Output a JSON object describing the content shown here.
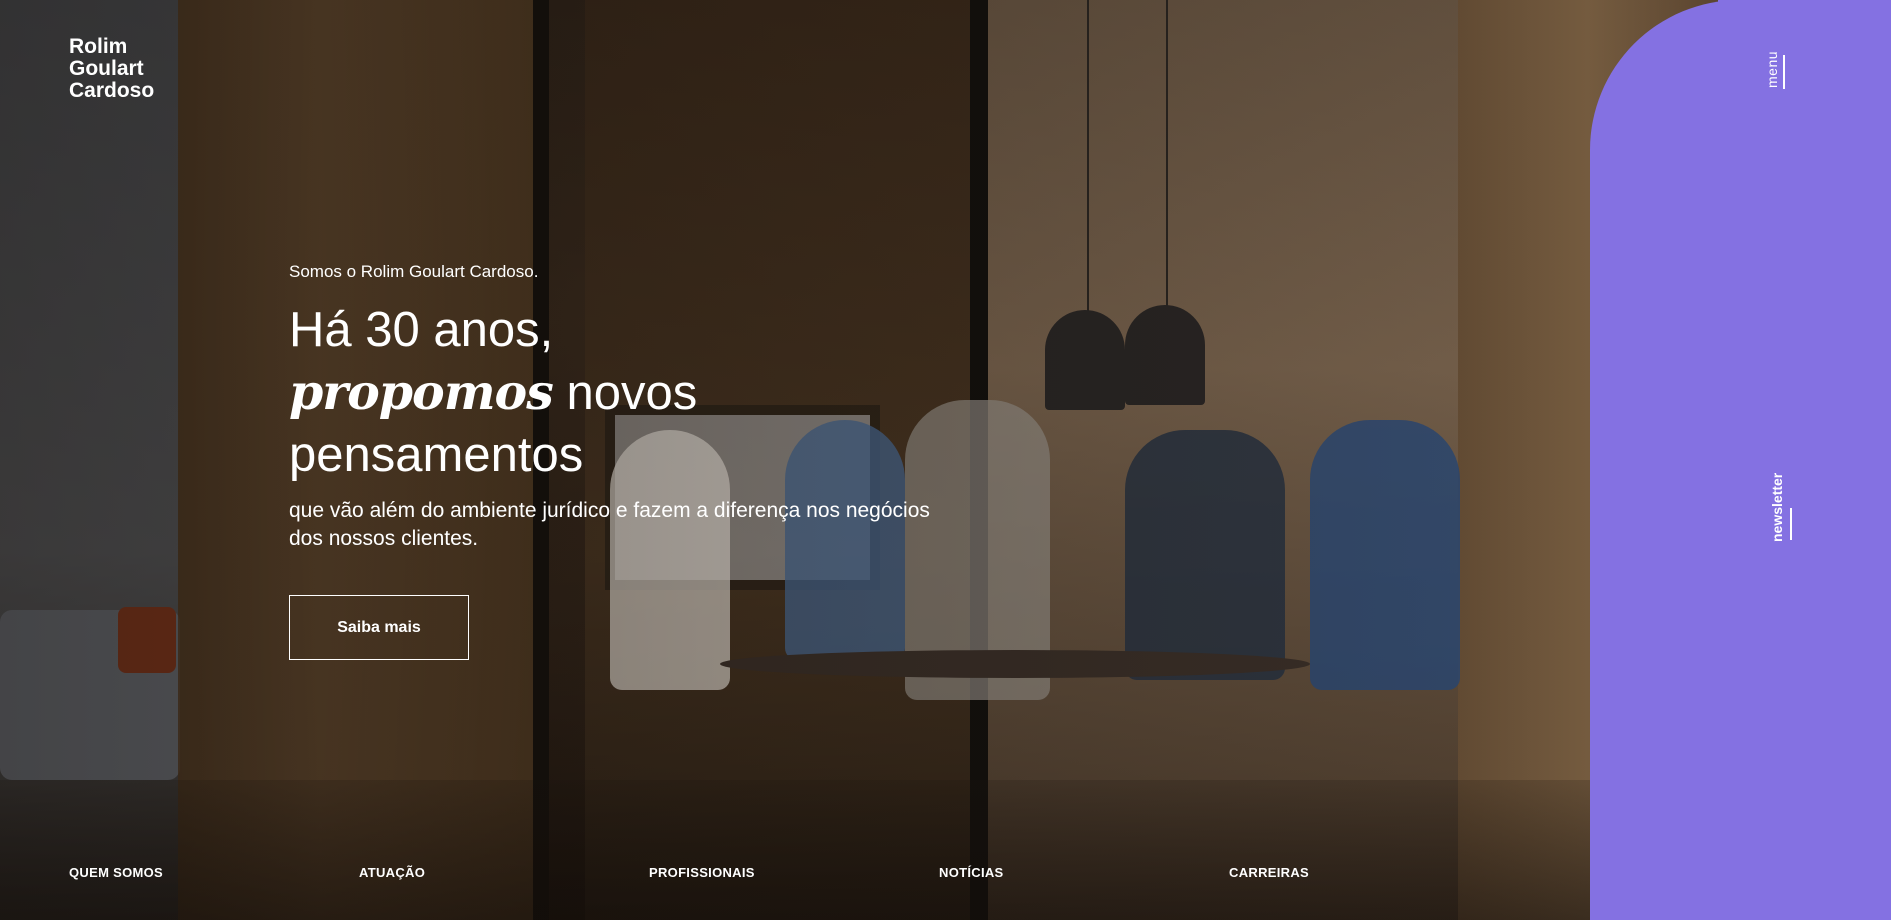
{
  "brand": {
    "logo_lines": [
      "Rolim",
      "Goulart",
      "Cardoso"
    ]
  },
  "side_panel": {
    "menu_label": "menu",
    "newsletter_label": "newsletter",
    "accent_color": "#8471e2"
  },
  "hero": {
    "eyebrow": "Somos o Rolim Goulart Cardoso.",
    "headline_line1": "Há 30 anos,",
    "headline_emphasis": "propomos",
    "headline_line2_rest": " novos",
    "headline_line3": "pensamentos",
    "subtext": "que vão além do ambiente jurídico e fazem a diferença nos negócios dos nossos clientes.",
    "cta_label": "Saiba mais"
  },
  "bottom_nav": {
    "items": [
      {
        "label": "QUEM SOMOS"
      },
      {
        "label": "ATUAÇÃO"
      },
      {
        "label": "PROFISSIONAIS"
      },
      {
        "label": "NOTÍCIAS"
      },
      {
        "label": "CARREIRAS"
      }
    ]
  }
}
